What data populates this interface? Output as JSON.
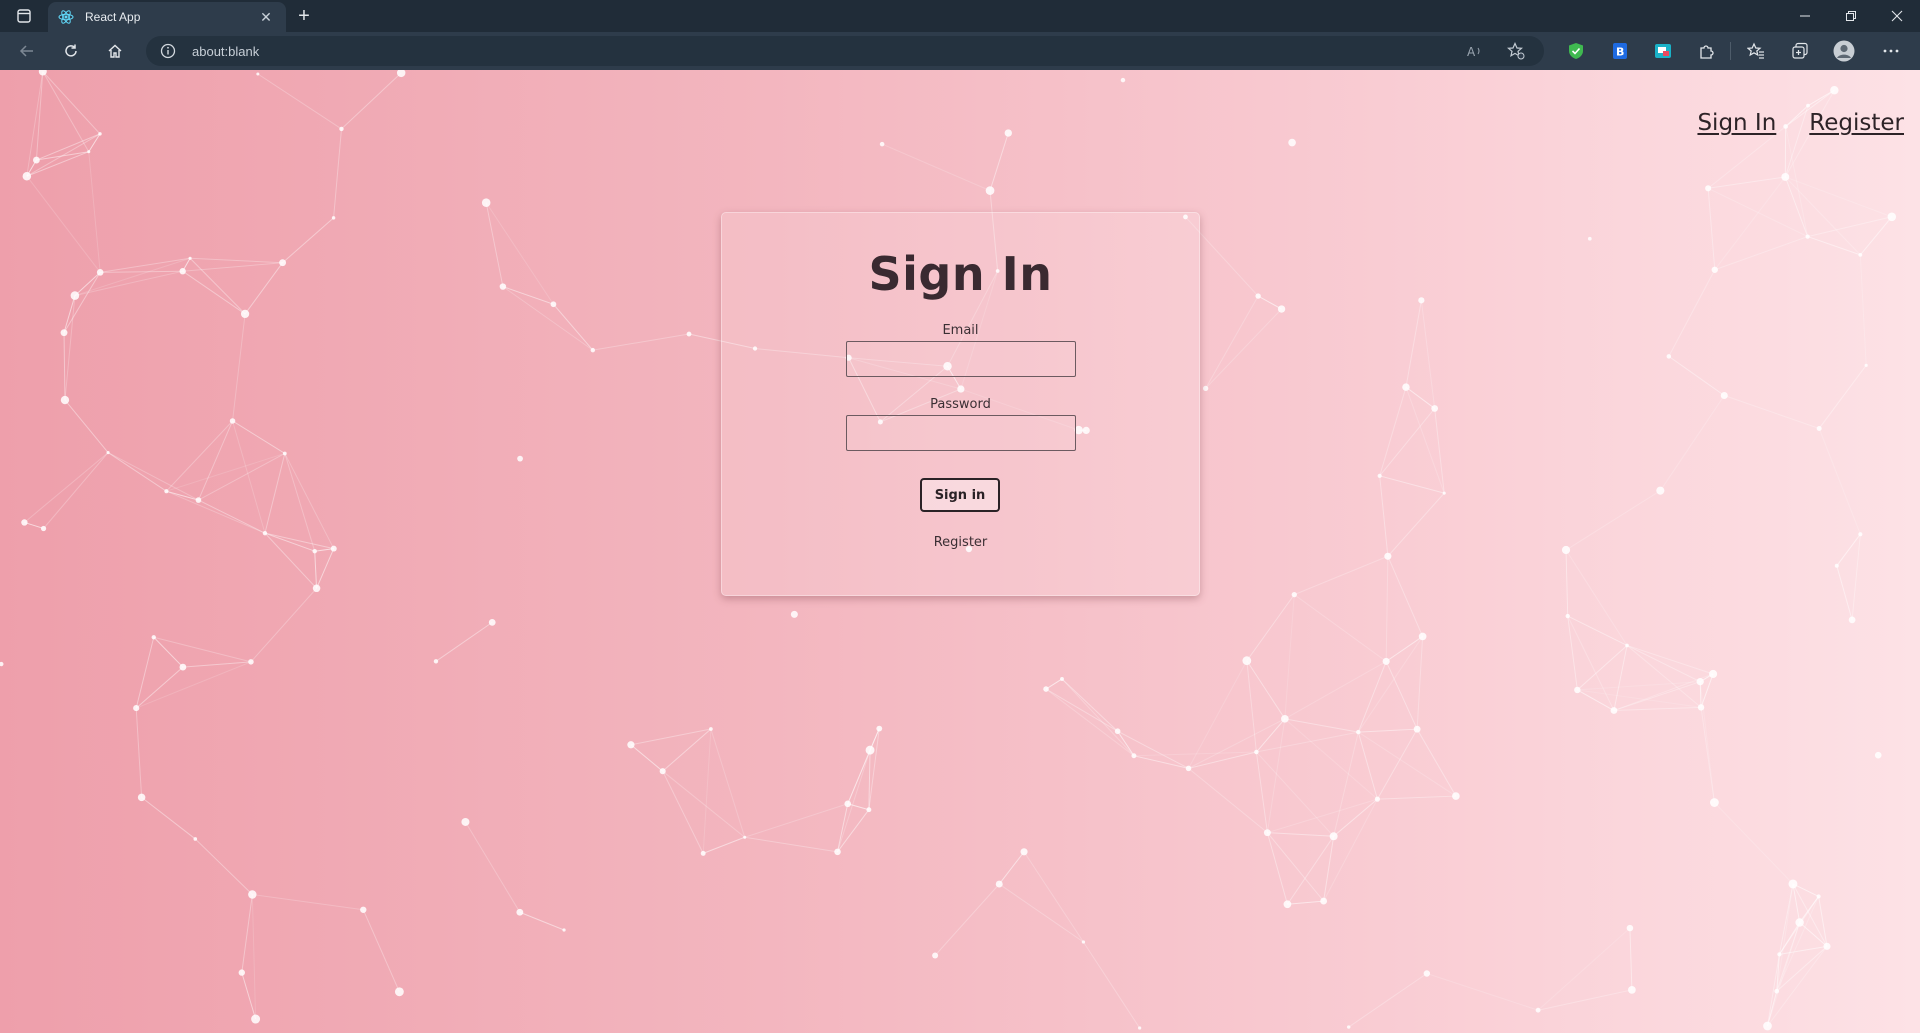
{
  "browser": {
    "tab": {
      "title": "React App",
      "favicon": "react-logo-icon",
      "close_icon": "close-icon"
    },
    "new_tab_icon": "plus-icon",
    "address": {
      "url": "about:blank",
      "info_icon": "info-icon"
    },
    "toolbar_icons": [
      "back-icon",
      "refresh-icon",
      "home-icon",
      "read-aloud-icon",
      "add-favorite-icon",
      "shield-extension-icon",
      "bitwarden-extension-icon",
      "screen-capture-extension-icon",
      "extensions-icon",
      "favorites-icon",
      "collections-icon",
      "profile-icon",
      "more-icon"
    ],
    "window_controls": [
      "minimize-icon",
      "restore-icon",
      "close-window-icon"
    ]
  },
  "page": {
    "nav": {
      "sign_in": "Sign In",
      "register": "Register"
    },
    "form": {
      "title": "Sign In",
      "email_label": "Email",
      "email_value": "",
      "password_label": "Password",
      "password_value": "",
      "submit_label": "Sign in",
      "register_link": "Register"
    },
    "colors": {
      "gradient_start": "#ee9fab",
      "gradient_end": "#fde2e6",
      "chrome_dark": "#202c38",
      "chrome_toolbar": "#2e3c4b"
    }
  }
}
